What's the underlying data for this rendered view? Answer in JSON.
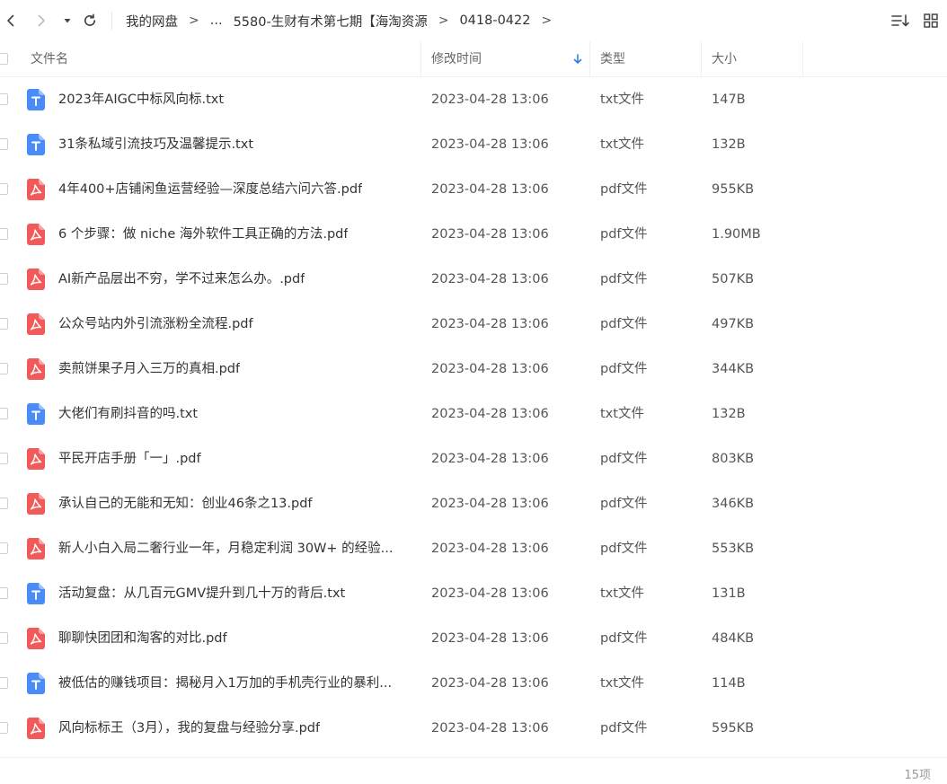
{
  "nav": {
    "breadcrumb": [
      "我的网盘",
      "...",
      "5580-生财有术第七期【海淘资源",
      "0418-0422"
    ],
    "separator": ">"
  },
  "colors": {
    "txt_icon": "#4a8cf7",
    "pdf_icon": "#f25a5a",
    "sort_arrow": "#2f80ed"
  },
  "table": {
    "headers": {
      "name": "文件名",
      "time": "修改时间",
      "type": "类型",
      "size": "大小"
    },
    "sort_indicator": "arrow-down-icon",
    "rows": [
      {
        "name": "2023年AIGC中标风向标.txt",
        "time": "2023-04-28 13:06",
        "type": "txt文件",
        "size": "147B",
        "icon": "txt-file-icon"
      },
      {
        "name": "31条私域引流技巧及温馨提示.txt",
        "time": "2023-04-28 13:06",
        "type": "txt文件",
        "size": "132B",
        "icon": "txt-file-icon"
      },
      {
        "name": "4年400+店铺闲鱼运营经验—深度总结六问六答.pdf",
        "time": "2023-04-28 13:06",
        "type": "pdf文件",
        "size": "955KB",
        "icon": "pdf-file-icon"
      },
      {
        "name": "6 个步骤：做 niche 海外软件工具正确的方法.pdf",
        "time": "2023-04-28 13:06",
        "type": "pdf文件",
        "size": "1.90MB",
        "icon": "pdf-file-icon"
      },
      {
        "name": "AI新产品层出不穷，学不过来怎么办。.pdf",
        "time": "2023-04-28 13:06",
        "type": "pdf文件",
        "size": "507KB",
        "icon": "pdf-file-icon"
      },
      {
        "name": "公众号站内外引流涨粉全流程.pdf",
        "time": "2023-04-28 13:06",
        "type": "pdf文件",
        "size": "497KB",
        "icon": "pdf-file-icon"
      },
      {
        "name": "卖煎饼果子月入三万的真相.pdf",
        "time": "2023-04-28 13:06",
        "type": "pdf文件",
        "size": "344KB",
        "icon": "pdf-file-icon"
      },
      {
        "name": "大佬们有刷抖音的吗.txt",
        "time": "2023-04-28 13:06",
        "type": "txt文件",
        "size": "132B",
        "icon": "txt-file-icon"
      },
      {
        "name": "平民开店手册「一」.pdf",
        "time": "2023-04-28 13:06",
        "type": "pdf文件",
        "size": "803KB",
        "icon": "pdf-file-icon"
      },
      {
        "name": "承认自己的无能和无知：创业46条之13.pdf",
        "time": "2023-04-28 13:06",
        "type": "pdf文件",
        "size": "346KB",
        "icon": "pdf-file-icon"
      },
      {
        "name": "新人小白入局二奢行业一年，月稳定利润 30W+ 的经验...",
        "time": "2023-04-28 13:06",
        "type": "pdf文件",
        "size": "553KB",
        "icon": "pdf-file-icon"
      },
      {
        "name": "活动复盘：从几百元GMV提升到几十万的背后.txt",
        "time": "2023-04-28 13:06",
        "type": "txt文件",
        "size": "131B",
        "icon": "txt-file-icon"
      },
      {
        "name": "聊聊快团团和淘客的对比.pdf",
        "time": "2023-04-28 13:06",
        "type": "pdf文件",
        "size": "484KB",
        "icon": "pdf-file-icon"
      },
      {
        "name": "被低估的赚钱项目：揭秘月入1万加的手机壳行业的暴利...",
        "time": "2023-04-28 13:06",
        "type": "txt文件",
        "size": "114B",
        "icon": "txt-file-icon"
      },
      {
        "name": "风向标标王（3月），我的复盘与经验分享.pdf",
        "time": "2023-04-28 13:06",
        "type": "pdf文件",
        "size": "595KB",
        "icon": "pdf-file-icon"
      }
    ]
  },
  "footer": {
    "count": "15项"
  }
}
